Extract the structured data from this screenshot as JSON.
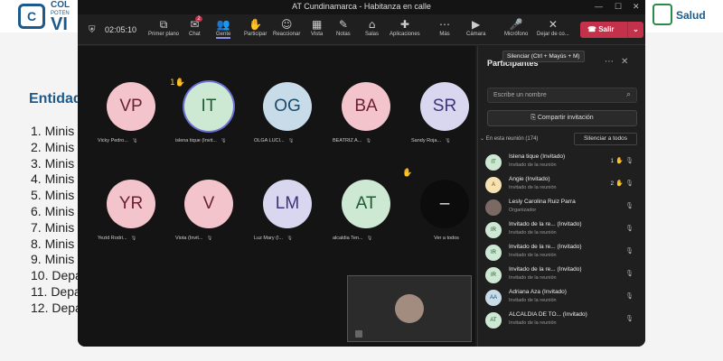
{
  "window": {
    "title": "AT Cundinamarca - Habitanza en calle"
  },
  "slide": {
    "logo_top": "COL",
    "logo_sub": "POTEN",
    "logo_big": "VI",
    "ministry": "Salud",
    "heading": "Entidad",
    "items": [
      "1. Minis",
      "2. Minis",
      "3. Minis",
      "4. Minis",
      "5. Minis",
      "6. Minis",
      "7. Minis",
      "8. Minis",
      "9. Minis",
      "10. Depa",
      "11. Depa",
      "12. Depa"
    ]
  },
  "toolbar": {
    "timer": "02:05:10",
    "buttons": [
      {
        "label": "Primer plano",
        "icon": "⧉",
        "name": "focus-icon"
      },
      {
        "label": "Chat",
        "icon": "✉",
        "name": "chat-icon",
        "badge": "2"
      },
      {
        "label": "Gente",
        "icon": "👥",
        "name": "people-icon",
        "active": true
      },
      {
        "label": "Participar",
        "icon": "✋",
        "name": "raise-hand-icon"
      },
      {
        "label": "Reaccionar",
        "icon": "☺",
        "name": "react-icon"
      },
      {
        "label": "Vista",
        "icon": "▦",
        "name": "view-icon"
      },
      {
        "label": "Notas",
        "icon": "✎",
        "name": "notes-icon"
      },
      {
        "label": "Salas",
        "icon": "⌂",
        "name": "rooms-icon"
      },
      {
        "label": "Aplicaciones",
        "icon": "✚",
        "name": "apps-icon"
      },
      {
        "label": "Más",
        "icon": "⋯",
        "name": "more-icon"
      },
      {
        "label": "Cámara",
        "icon": "▶",
        "name": "camera-icon"
      },
      {
        "label": "Micrófono",
        "icon": "🎤",
        "name": "mic-icon"
      },
      {
        "label": "Dejar de co...",
        "icon": "✕",
        "name": "stop-share-icon"
      }
    ],
    "leave": "Salir",
    "tooltip": "Silenciar (Ctrl + Mayús + M)"
  },
  "stage": {
    "tiles": [
      {
        "initials": "VP",
        "name": "Vicky Pedro...",
        "bg": "#f4c4cc",
        "fg": "#6b2035"
      },
      {
        "initials": "IT",
        "name": "islena tique (Invit...",
        "bg": "#cde8d3",
        "fg": "#1f5a32",
        "hand": "1✋"
      },
      {
        "initials": "OG",
        "name": "OLGA LUCI...",
        "bg": "#c8dbe9",
        "fg": "#1c4a6b"
      },
      {
        "initials": "BA",
        "name": "BEATRIZ A...",
        "bg": "#f4c4cc",
        "fg": "#6b2035"
      },
      {
        "initials": "SR",
        "name": "Sandy Roja...",
        "bg": "#d9d6f0",
        "fg": "#3c3477"
      },
      {
        "initials": "YR",
        "name": "Yezid Rodri...",
        "bg": "#f4c4cc",
        "fg": "#6b2035"
      },
      {
        "initials": "V",
        "name": "Viota (Invit...",
        "bg": "#f4c4cc",
        "fg": "#6b2035"
      },
      {
        "initials": "LM",
        "name": "Luz Mary (I...",
        "bg": "#d9d6f0",
        "fg": "#3c3477"
      },
      {
        "initials": "AT",
        "name": "alcaldia Ten...",
        "bg": "#cde8d3",
        "fg": "#1f5a32"
      },
      {
        "initials": "–",
        "name": "Ver a todos",
        "bg": "#0c0c0c",
        "fg": "#eeeeee",
        "hand": "✋"
      }
    ]
  },
  "panel": {
    "title": "Participantes",
    "search_placeholder": "Escribe un nombre",
    "share_invite": "Compartir invitación",
    "in_meeting": "En esta reunión (174)",
    "mute_all": "Silenciar a todos",
    "participants": [
      {
        "initials": "IT",
        "name": "Islena tique (Invitado)",
        "role": "Invitado de la reunión",
        "num": "1",
        "hand": true,
        "bg": "#cde8d3",
        "fg": "#1f5a32"
      },
      {
        "initials": "A",
        "name": "Angie (Invitado)",
        "role": "Invitado de la reunión",
        "num": "2",
        "hand": true,
        "bg": "#f5e2b0",
        "fg": "#6b4a10"
      },
      {
        "initials": "",
        "name": "Lesly Carolina Ruiz Parra",
        "role": "Organizador",
        "bg": "#7a6a63",
        "fg": "#ffffff"
      },
      {
        "initials": "IR",
        "name": "Invitado de la re... (Invitado)",
        "role": "Invitado de la reunión",
        "bg": "#cde8d3",
        "fg": "#1f5a32"
      },
      {
        "initials": "IR",
        "name": "Invitado de la re... (Invitado)",
        "role": "Invitado de la reunión",
        "bg": "#cde8d3",
        "fg": "#1f5a32"
      },
      {
        "initials": "IR",
        "name": "Invitado de la re... (Invitado)",
        "role": "Invitado de la reunión",
        "bg": "#cde8d3",
        "fg": "#1f5a32"
      },
      {
        "initials": "AA",
        "name": "Adriana Aza (Invitado)",
        "role": "Invitado de la reunión",
        "bg": "#c8dbe9",
        "fg": "#1c4a6b"
      },
      {
        "initials": "AT",
        "name": "ALCALDIA DE TO... (Invitado)",
        "role": "Invitado de la reunión",
        "bg": "#cde8d3",
        "fg": "#1f5a32"
      }
    ]
  }
}
